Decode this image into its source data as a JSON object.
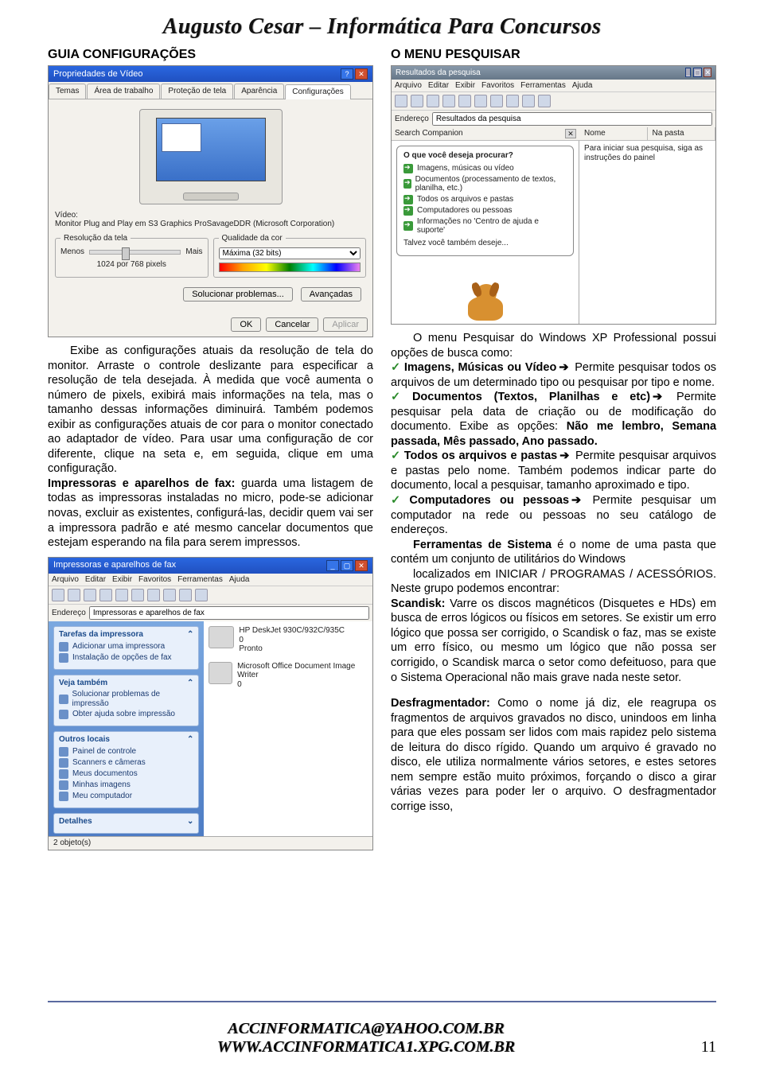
{
  "header_title": "Augusto Cesar – Informática Para Concursos",
  "left_heading": "GUIA CONFIGURAÇÕES",
  "right_heading": "O MENU PESQUISAR",
  "video_dialog": {
    "title": "Propriedades de Vídeo",
    "tabs": [
      "Temas",
      "Área de trabalho",
      "Proteção de tela",
      "Aparência",
      "Configurações"
    ],
    "video_label": "Vídeo:",
    "video_device": "Monitor Plug and Play em S3 Graphics ProSavageDDR (Microsoft Corporation)",
    "res_legend": "Resolução da tela",
    "res_less": "Menos",
    "res_more": "Mais",
    "res_value": "1024 por 768 pixels",
    "color_legend": "Qualidade da cor",
    "color_value": "Máxima (32 bits)",
    "btn_trouble": "Solucionar problemas...",
    "btn_adv": "Avançadas",
    "btn_ok": "OK",
    "btn_cancel": "Cancelar",
    "btn_apply": "Aplicar"
  },
  "left_body_1": "Exibe as configurações atuais da resolução de tela do monitor. Arraste o controle deslizante para especificar a resolução de tela desejada. À medida que você aumenta o número de pixels, exibirá mais informações na tela, mas o tamanho dessas informações diminuirá. Também podemos exibir as configurações atuais de cor para o monitor conectado ao adaptador de vídeo. Para usar uma configuração de cor diferente, clique na seta e, em seguida, clique em uma configuração.",
  "left_body_2a": "Impressoras e aparelhos de fax:",
  "left_body_2b": " guarda uma listagem de todas as impressoras instaladas no micro, pode-se adicionar novas, excluir as existentes, configurá-las, decidir quem vai ser a impressora padrão e até mesmo cancelar documentos que estejam esperando na fila para serem impressos.",
  "printers": {
    "title": "Impressoras e aparelhos de fax",
    "menus": [
      "Arquivo",
      "Editar",
      "Exibir",
      "Favoritos",
      "Ferramentas",
      "Ajuda"
    ],
    "addr_label": "Endereço",
    "addr_value": "Impressoras e aparelhos de fax",
    "panel1_title": "Tarefas da impressora",
    "panel1_items": [
      "Adicionar uma impressora",
      "Instalação de opções de fax"
    ],
    "panel2_title": "Veja também",
    "panel2_items": [
      "Solucionar problemas de impressão",
      "Obter ajuda sobre impressão"
    ],
    "panel3_title": "Outros locais",
    "panel3_items": [
      "Painel de controle",
      "Scanners e câmeras",
      "Meus documentos",
      "Minhas imagens",
      "Meu computador"
    ],
    "panel4_title": "Detalhes",
    "items": [
      {
        "name": "HP DeskJet 930C/932C/935C",
        "status": "0",
        "line2": "Pronto"
      },
      {
        "name": "Microsoft Office Document Image Writer",
        "status": "0",
        "line2": ""
      }
    ],
    "status": "2 objeto(s)"
  },
  "search": {
    "title": "Resultados da pesquisa",
    "menus": [
      "Arquivo",
      "Editar",
      "Exibir",
      "Favoritos",
      "Ferramentas",
      "Ajuda"
    ],
    "addr_label": "Endereço",
    "addr_value": "Resultados da pesquisa",
    "sc_label": "Search Companion",
    "balloon_q": "O que você deseja procurar?",
    "balloon_opts": [
      "Imagens, músicas ou vídeo",
      "Documentos (processamento de textos, planilha, etc.)",
      "Todos os arquivos e pastas",
      "Computadores ou pessoas",
      "Informações no 'Centro de ajuda e suporte'"
    ],
    "balloon_tail": "Talvez você também deseje...",
    "col_name": "Nome",
    "col_folder": "Na pasta",
    "hint": "Para iniciar sua pesquisa, siga as instruções do painel"
  },
  "right_body": {
    "intro": "O menu Pesquisar do Windows XP Professional possui opções de busca como:",
    "b1a": "Imagens, Músicas ou Vídeo",
    "b1b": " Permite pesquisar todos os arquivos de um determinado tipo ou pesquisar por tipo e nome.",
    "b2a": "Documentos (Textos, Planilhas e etc)",
    "b2b": " Permite pesquisar pela data de criação ou de modificação do documento. Exibe as opções: ",
    "b2c": "Não me lembro, Semana passada, Mês passado, Ano passado.",
    "b3a": "Todos os arquivos e pastas",
    "b3b": " Permite pesquisar arquivos e pastas pelo nome. Também podemos indicar parte do documento, local a pesquisar, tamanho aproximado e tipo.",
    "b4a": "Computadores ou pessoas",
    "b4b": " Permite pesquisar um computador na rede ou pessoas no seu catálogo de endereços.",
    "sys1a": "Ferramentas de Sistema",
    "sys1b": " é o nome de uma pasta que contém um conjunto de utilitários do Windows",
    "sys2": "localizados em INICIAR / PROGRAMAS / ACESSÓRIOS. Neste grupo podemos encontrar:",
    "scan_a": "Scandisk:",
    "scan_b": " Varre os discos magnéticos (Disquetes e HDs) em busca de erros lógicos ou físicos em setores. Se existir um erro lógico que possa ser corrigido, o Scandisk o faz, mas se existe um erro físico, ou mesmo um lógico que não possa ser corrigido, o Scandisk marca o setor como defeituoso, para que o Sistema Operacional não mais grave nada neste setor.",
    "def_a": "Desfragmentador:",
    "def_b": " Como o nome já diz, ele reagrupa os fragmentos de arquivos gravados no disco, unindoos em linha para que eles possam ser lidos com mais rapidez pelo sistema de leitura do disco rígido. Quando um arquivo é gravado no disco, ele utiliza normalmente vários setores, e estes setores nem sempre estão muito próximos, forçando o disco a girar várias vezes para poder ler o arquivo. O desfragmentador corrige isso,"
  },
  "footer_email": "ACCINFORMATICA@YAHOO.COM.BR",
  "footer_url": "WWW.ACCINFORMATICA1.XPG.COM.BR",
  "page_number": "11"
}
